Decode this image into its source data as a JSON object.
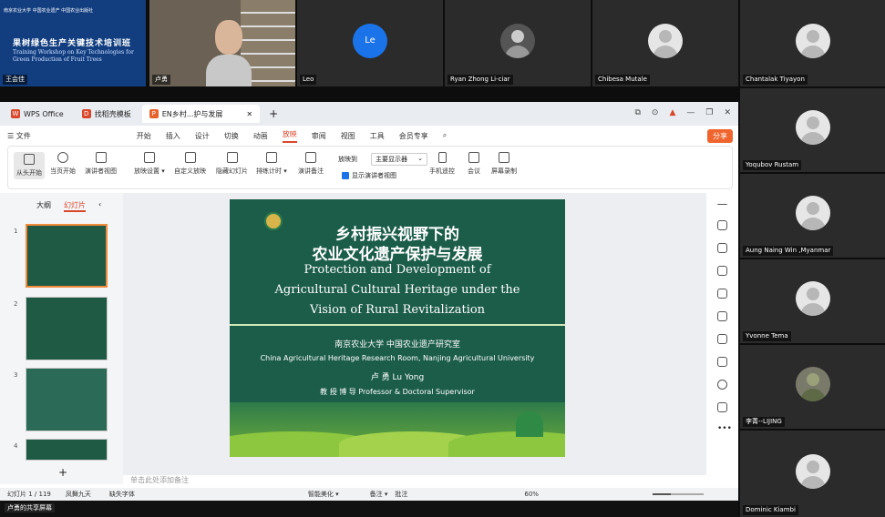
{
  "participants_top": [
    {
      "name": "王会佳",
      "kind": "banner"
    },
    {
      "name": "卢勇",
      "kind": "video"
    },
    {
      "name": "Leo",
      "kind": "initial",
      "initial": "Le"
    },
    {
      "name": "Ryan Zhong Li-ciar",
      "kind": "robot"
    },
    {
      "name": "Chibesa Mutale",
      "kind": "avatar"
    },
    {
      "name": "Chantalak Tiyayon",
      "kind": "avatar"
    }
  ],
  "participants_side": [
    {
      "name": "Yoqubov Rustam"
    },
    {
      "name": "Aung Naing Win ,Myanmar"
    },
    {
      "name": "Yvonne Tema"
    },
    {
      "name": "李菁--LIJING"
    },
    {
      "name": "Dominic Kiambi"
    }
  ],
  "banner": {
    "logos": "南京农业大学  中国农业遗产  中国农业出版社",
    "title_cn": "果树绿色生产关键技术培训班",
    "title_en": "Training Workshop on Key Technologies for Green Production of Fruit Trees"
  },
  "presenter_label": "卢勇的共享屏幕",
  "wps": {
    "tabs": [
      {
        "label": "WPS Office",
        "icon": "W",
        "color": "#d9472b"
      },
      {
        "label": "找稻壳模板",
        "icon": "D",
        "color": "#d9472b"
      },
      {
        "label": "EN乡村...护与发展",
        "icon": "P",
        "color": "#e8622c"
      }
    ],
    "window_controls": [
      "⧉",
      "⊙",
      "▲",
      "—",
      "❐",
      "✕"
    ],
    "menu": [
      "☰ 文件",
      "开始",
      "插入",
      "设计",
      "切换",
      "动画",
      "放映",
      "审阅",
      "视图",
      "工具",
      "会员专享"
    ],
    "active_menu": "放映",
    "share_label": "分享",
    "ribbon": [
      "从头开始",
      "当页开始",
      "演讲者视图",
      "放映设置 ▾",
      "自定义放映",
      "隐藏幻灯片",
      "排练计时 ▾",
      "演讲备注"
    ],
    "ribbon_right": [
      "手机遥控",
      "会议",
      "屏幕录制"
    ],
    "play_to_label": "放映到",
    "play_to_value": "主要显示器",
    "show_presenter": "显示演讲者视图",
    "panel_tabs": [
      "大纲",
      "幻灯片"
    ],
    "slide_numbers": [
      "1",
      "2",
      "3",
      "4"
    ],
    "notes_placeholder": "单击此处添加备注",
    "status": {
      "slide": "幻灯片 1 / 119",
      "theme": "凤舞九天",
      "missing_font": "缺失字体",
      "beautify": "智能美化 ▾",
      "notes": "备注 ▾",
      "comments": "批注",
      "zoom": "60%",
      "zoom_fraction": 0.35
    }
  },
  "slide": {
    "title_cn_1": "乡村振兴视野下的",
    "title_cn_2": "农业文化遗产保护与发展",
    "title_en_1": "Protection and Development of",
    "title_en_2": "Agricultural Cultural Heritage under the",
    "title_en_3": "Vision of Rural Revitalization",
    "org_cn": "南京农业大学 中国农业遗产研究室",
    "org_en": "China Agricultural Heritage Research Room, Nanjing Agricultural University",
    "author": "卢  勇   Lu Yong",
    "position": "教 授  博 导 Professor & Doctoral Supervisor"
  }
}
